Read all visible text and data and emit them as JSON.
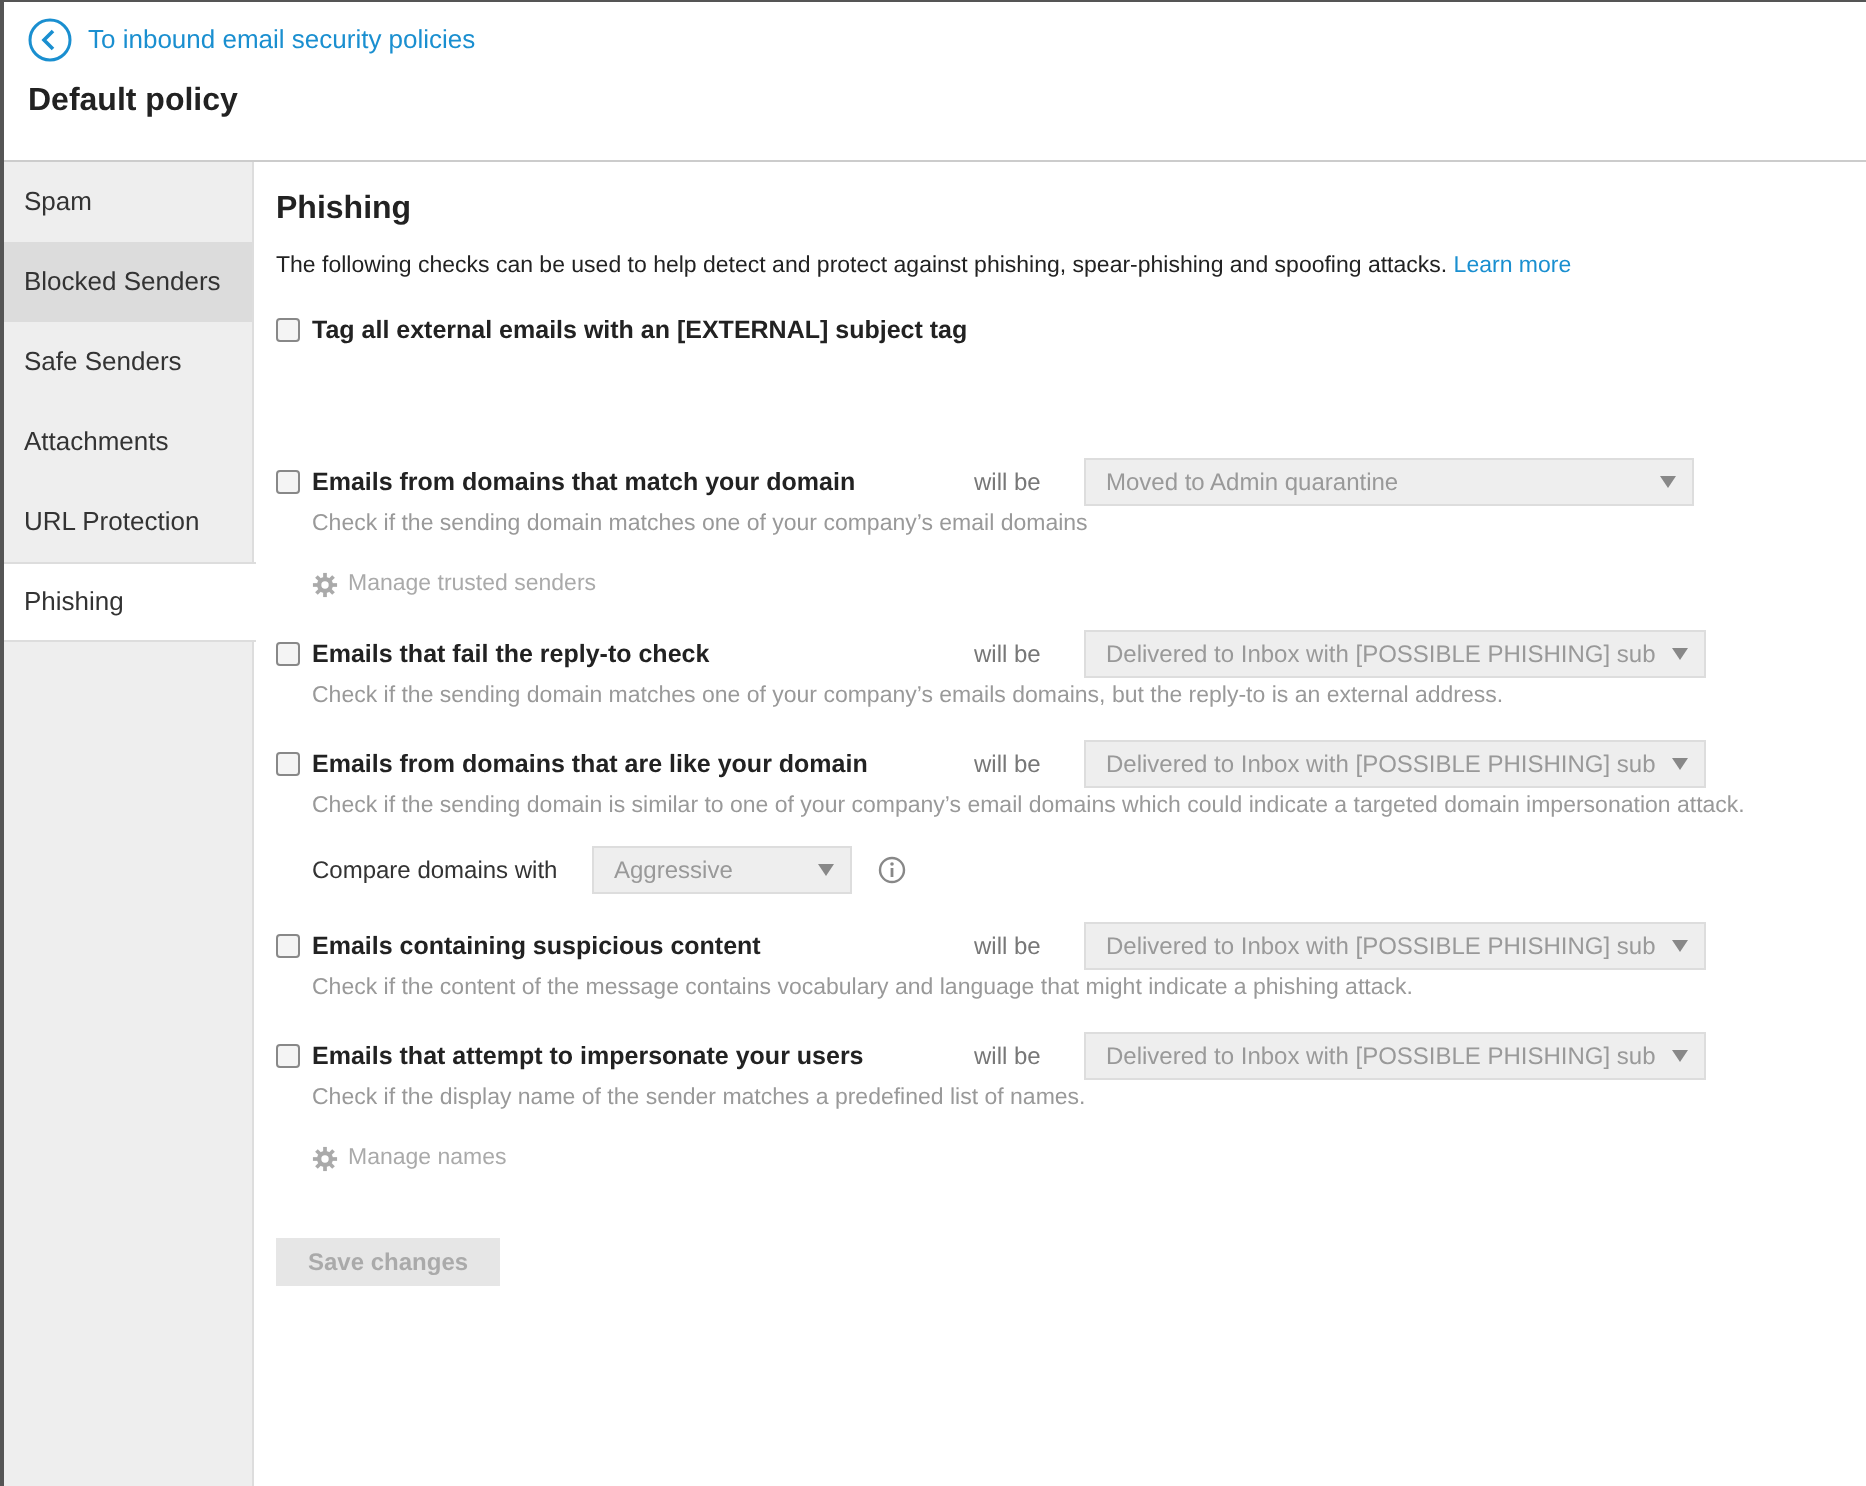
{
  "back_link": {
    "label": "To inbound email security policies"
  },
  "page_title": "Default policy",
  "sidebar": {
    "items": [
      {
        "label": "Spam",
        "selected": false,
        "hovered": false
      },
      {
        "label": "Blocked Senders",
        "selected": false,
        "hovered": true
      },
      {
        "label": "Safe Senders",
        "selected": false,
        "hovered": false
      },
      {
        "label": "Attachments",
        "selected": false,
        "hovered": false
      },
      {
        "label": "URL Protection",
        "selected": false,
        "hovered": false
      },
      {
        "label": "Phishing",
        "selected": true,
        "hovered": false
      }
    ]
  },
  "section": {
    "title": "Phishing",
    "intro": "The following checks can be used to help detect and protect against phishing, spear-phishing and spoofing attacks.",
    "learn_more": "Learn more"
  },
  "checks": [
    {
      "kind": "simple",
      "label": "Tag all external emails with an [EXTERNAL] subject tag",
      "checked": false
    },
    {
      "kind": "rule",
      "label": "Emails from domains that match your domain",
      "checked": false,
      "will_be": "will be",
      "action": "Moved to Admin quarantine",
      "description": "Check if the sending domain matches one of your company’s email domains",
      "link": "Manage trusted senders"
    },
    {
      "kind": "rule",
      "label": "Emails that fail the reply-to check",
      "checked": false,
      "will_be": "will be",
      "action": "Delivered to Inbox with [POSSIBLE PHISHING] sub",
      "description": "Check if the sending domain matches one of your company’s emails domains, but the reply-to is an external address."
    },
    {
      "kind": "rule",
      "label": "Emails from domains that are like your domain",
      "checked": false,
      "will_be": "will be",
      "action": "Delivered to Inbox with [POSSIBLE PHISHING] sub",
      "description": "Check if the sending domain is similar to one of your company’s email domains which could indicate a targeted domain impersonation attack.",
      "compare": {
        "label": "Compare domains with",
        "value": "Aggressive"
      }
    },
    {
      "kind": "rule",
      "label": "Emails containing suspicious content",
      "checked": false,
      "will_be": "will be",
      "action": "Delivered to Inbox with [POSSIBLE PHISHING] sub",
      "description": "Check if the content of the message contains vocabulary and language that might indicate a phishing attack."
    },
    {
      "kind": "rule",
      "label": "Emails that attempt to impersonate your users",
      "checked": false,
      "will_be": "will be",
      "action": "Delivered to Inbox with [POSSIBLE PHISHING] sub",
      "description": "Check if the display name of the sender matches a predefined list of names.",
      "link": "Manage names"
    }
  ],
  "save_button": {
    "label": "Save changes",
    "disabled": true
  }
}
